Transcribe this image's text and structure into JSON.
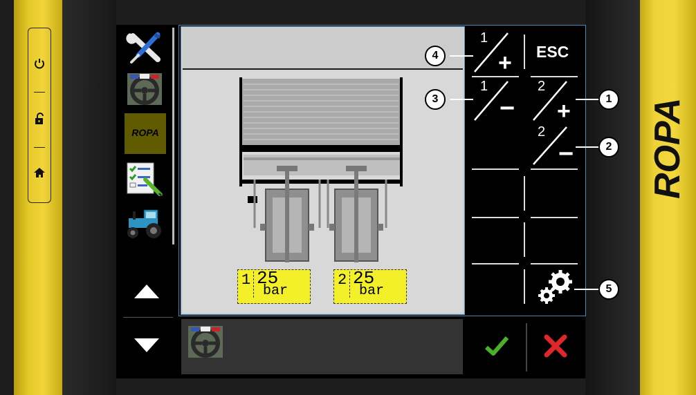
{
  "device": {
    "brand_text": "ROPA",
    "side_buttons": [
      {
        "icon": "power-icon",
        "glyph": "⏻"
      },
      {
        "icon": "unlock-icon",
        "glyph": "🔓"
      },
      {
        "icon": "home-icon",
        "glyph": "⌂"
      }
    ]
  },
  "sidebar": {
    "items": [
      {
        "name": "tools",
        "icon": "wrench-screwdriver-icon"
      },
      {
        "name": "steering",
        "icon": "steering-wheel-icon"
      },
      {
        "name": "ropa",
        "label": "ROPA"
      },
      {
        "name": "checklist",
        "icon": "checklist-icon"
      },
      {
        "name": "tractor",
        "icon": "tractor-icon"
      }
    ],
    "up_icon": "arrow-up-icon",
    "down_icon": "arrow-down-icon"
  },
  "softkeys": {
    "k1_plus": {
      "num": "1",
      "sign": "+"
    },
    "k1_minus": {
      "num": "1",
      "sign": "−"
    },
    "k2_plus": {
      "num": "2",
      "sign": "+"
    },
    "k2_minus": {
      "num": "2",
      "sign": "−"
    },
    "esc": "ESC",
    "settings_icon": "gears-icon"
  },
  "pressure": [
    {
      "index": "1",
      "value": "25",
      "unit": "bar"
    },
    {
      "index": "2",
      "value": "25",
      "unit": "bar"
    }
  ],
  "callouts": [
    "1",
    "2",
    "3",
    "4",
    "5"
  ],
  "bottom": {
    "icon": "steering-wheel-icon",
    "confirm_icon": "checkmark-icon",
    "cancel_icon": "cross-icon"
  },
  "colors": {
    "yellow": "#f1d53a",
    "label_yellow": "#f3f02a",
    "confirm_green": "#4caf2a",
    "cancel_red": "#e0262a",
    "frame_blue": "#4b88b6"
  }
}
